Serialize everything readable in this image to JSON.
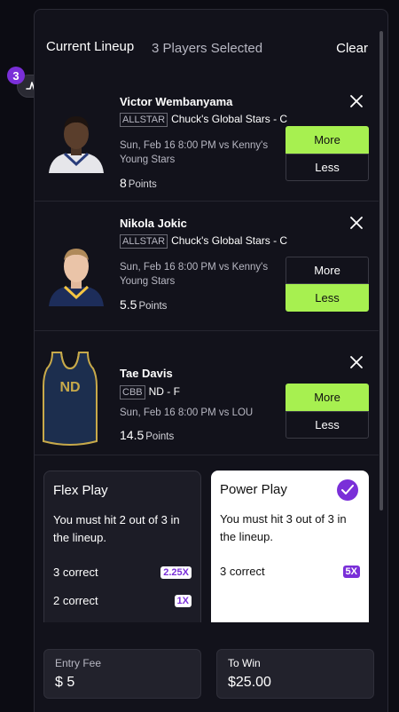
{
  "header": {
    "title": "Current Lineup",
    "count": "3 Players Selected",
    "clear_label": "Clear"
  },
  "lineup_badge": {
    "count": "3",
    "icon": "pulse-icon"
  },
  "players": [
    {
      "name": "Victor Wembanyama",
      "tag": "ALLSTAR",
      "team_position": "Chuck's Global Stars - C",
      "game": "Sun, Feb 16 8:00 PM vs Kenny's Young Stars",
      "points": "8",
      "points_unit": "Points",
      "more_label": "More",
      "less_label": "Less",
      "selected": "More"
    },
    {
      "name": "Nikola Jokic",
      "tag": "ALLSTAR",
      "team_position": "Chuck's Global Stars - C",
      "game": "Sun, Feb 16 8:00 PM vs Kenny's Young Stars",
      "points": "5.5",
      "points_unit": "Points",
      "more_label": "More",
      "less_label": "Less",
      "selected": "Less"
    },
    {
      "name": "Tae Davis",
      "tag": "CBB",
      "team_position": "ND - F",
      "game": "Sun, Feb 16 8:00 PM vs LOU",
      "points": "14.5",
      "points_unit": "Points",
      "more_label": "More",
      "less_label": "Less",
      "selected": "More",
      "jersey_text": "ND"
    }
  ],
  "play_types": {
    "flex": {
      "title": "Flex Play",
      "description": "You must hit 2 out of 3 in the lineup.",
      "rows": [
        {
          "label": "3 correct",
          "multiplier": "2.25X"
        },
        {
          "label": "2 correct",
          "multiplier": "1X"
        }
      ]
    },
    "power": {
      "title": "Power Play",
      "description": "You must hit 3 out of 3 in the lineup.",
      "rows": [
        {
          "label": "3 correct",
          "multiplier": "5X"
        }
      ],
      "selected": true
    }
  },
  "entry": {
    "fee_label": "Entry Fee",
    "fee_value": "$ 5",
    "win_label": "To Win",
    "win_value": "$25.00"
  },
  "colors": {
    "accent_green": "#a7f050",
    "accent_purple": "#7a2fd8",
    "background": "#0c0c13"
  }
}
